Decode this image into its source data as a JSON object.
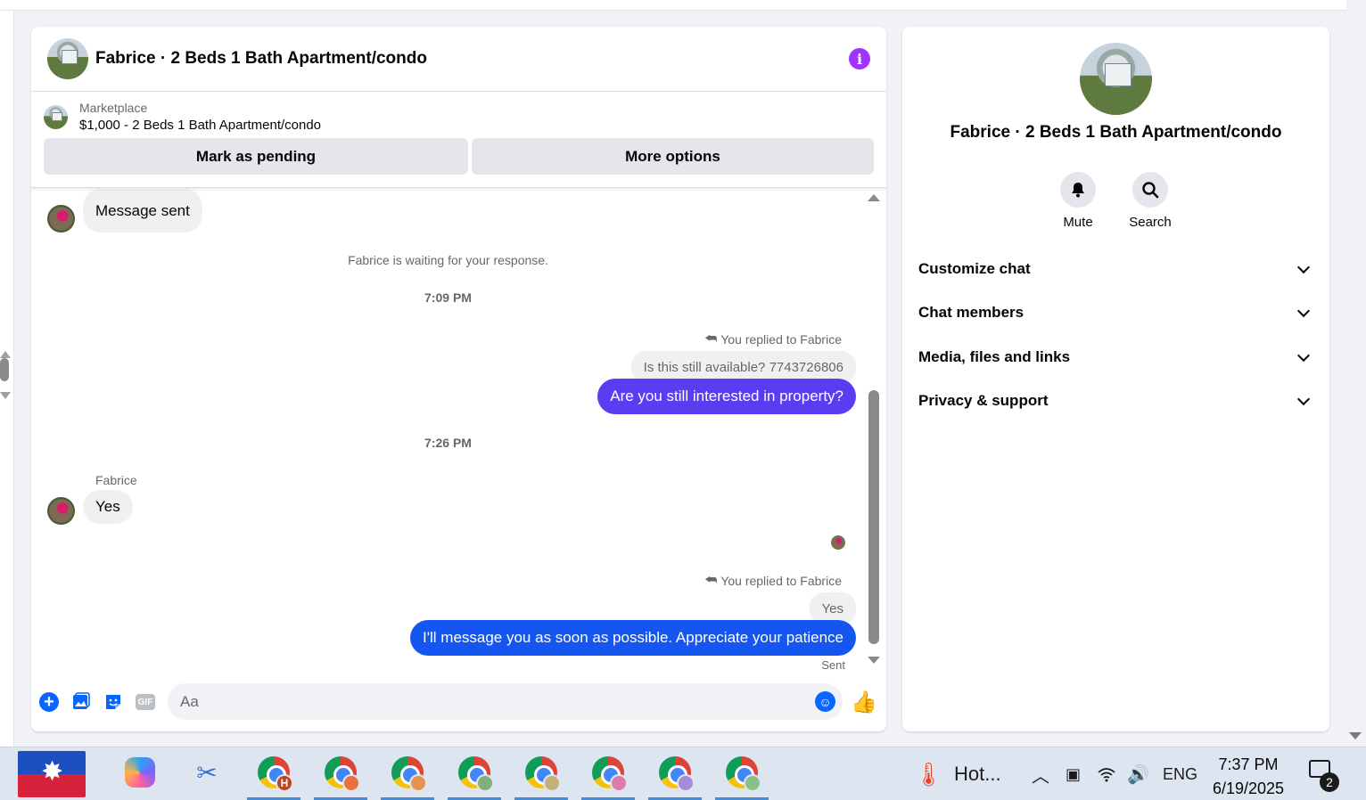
{
  "chat": {
    "title": "Fabrice · 2 Beds 1 Bath Apartment/condo",
    "listing": {
      "source": "Marketplace",
      "price_title": "$1,000 - 2 Beds 1 Bath Apartment/condo",
      "mark_pending": "Mark as pending",
      "more_options": "More options"
    },
    "messages": {
      "first": "Message sent",
      "waiting": "Fabrice is waiting for your response.",
      "time1": "7:09 PM",
      "reply1_label": "You replied to Fabrice",
      "reply1_quote": "Is this still available? 7743726806",
      "reply1_text": "Are you still interested in property?",
      "time2": "7:26 PM",
      "sender_name": "Fabrice",
      "incoming_yes": "Yes",
      "reply2_label": "You replied to Fabrice",
      "reply2_quote": "Yes",
      "reply2_text": "I'll message you as soon as possible. Appreciate your patience",
      "status": "Sent"
    },
    "composer": {
      "placeholder": "Aa",
      "gif": "GIF"
    },
    "colors": {
      "accent_purple": "#a033ff",
      "bubble_out_1": "#5b3cf0",
      "bubble_out_2": "#1656f0",
      "brand_blue": "#0866ff"
    }
  },
  "details": {
    "title": "Fabrice · 2 Beds 1 Bath Apartment/condo",
    "actions": [
      {
        "label": "Mute",
        "icon": "bell-icon"
      },
      {
        "label": "Search",
        "icon": "search-icon"
      }
    ],
    "sections": [
      {
        "label": "Customize chat"
      },
      {
        "label": "Chat members"
      },
      {
        "label": "Media, files and links"
      },
      {
        "label": "Privacy & support"
      }
    ]
  },
  "taskbar": {
    "weather": "Hot...",
    "language": "ENG",
    "time": "7:37 PM",
    "date": "6/19/2025",
    "notifications": "2",
    "chrome_badges": [
      "H",
      "profile-orange",
      "profile-orange",
      "profile-green",
      "profile-tan",
      "profile-pink",
      "profile-purple",
      "profile-green"
    ]
  }
}
